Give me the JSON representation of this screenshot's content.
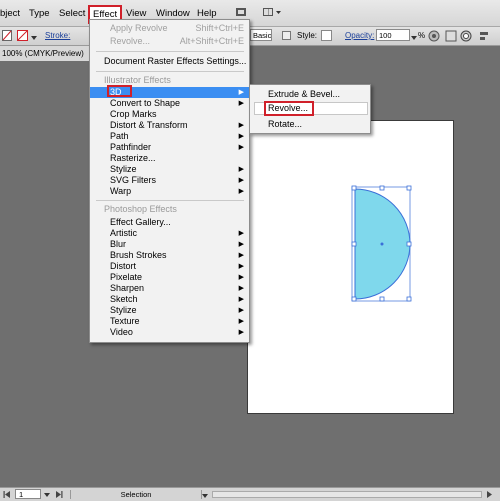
{
  "menubar": {
    "items": [
      "bject",
      "Type",
      "Select",
      "Effect",
      "View",
      "Window",
      "Help"
    ]
  },
  "controlbar": {
    "stroke_label": "Stroke:",
    "basic_value": "Basic",
    "style_label": "Style:",
    "opacity_label": "Opacity:",
    "opacity_value": "100",
    "percent": "%"
  },
  "doc_tab": "100% (CMYK/Preview)",
  "effect_menu": {
    "apply_revolve": {
      "label": "Apply Revolve",
      "shortcut": "Shift+Ctrl+E"
    },
    "revolve": {
      "label": "Revolve...",
      "shortcut": "Alt+Shift+Ctrl+E"
    },
    "document_raster": "Document Raster Effects Settings...",
    "illustrator_header": "Illustrator Effects",
    "illustrator_items": [
      "3D",
      "Convert to Shape",
      "Crop Marks",
      "Distort & Transform",
      "Path",
      "Pathfinder",
      "Rasterize...",
      "Stylize",
      "SVG Filters",
      "Warp"
    ],
    "photoshop_header": "Photoshop Effects",
    "photoshop_items": [
      "Effect Gallery...",
      "Artistic",
      "Blur",
      "Brush Strokes",
      "Distort",
      "Pixelate",
      "Sharpen",
      "Sketch",
      "Stylize",
      "Texture",
      "Video"
    ]
  },
  "submenu_3d": {
    "items": [
      "Extrude & Bevel...",
      "Revolve...",
      "Rotate..."
    ]
  },
  "statusbar": {
    "page_value": "1",
    "mode_label": "Selection"
  },
  "colors": {
    "accent": "#3b8ef2",
    "highlight_red": "#d0202a",
    "shape_fill": "#7fd8ec",
    "shape_stroke": "#3a6fd8"
  }
}
